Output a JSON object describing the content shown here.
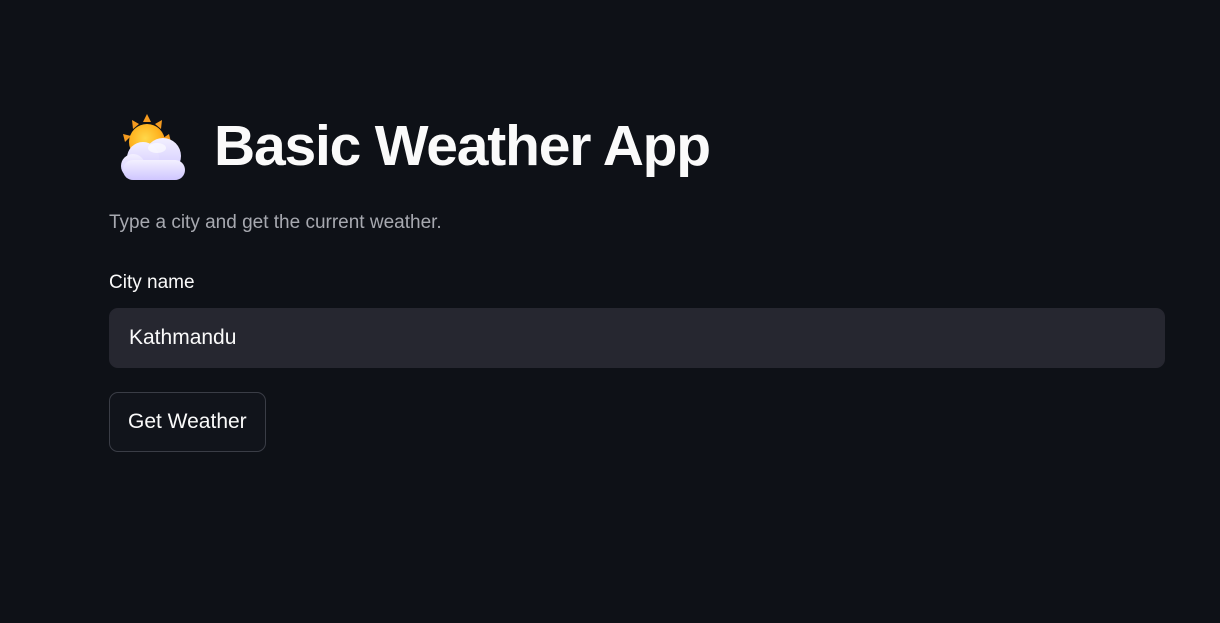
{
  "header": {
    "icon": "sun-behind-cloud-icon",
    "title": "Basic Weather App"
  },
  "main": {
    "subtitle": "Type a city and get the current weather.",
    "city_field": {
      "label": "City name",
      "value": "Kathmandu",
      "placeholder": ""
    },
    "get_weather_label": "Get Weather"
  },
  "colors": {
    "background": "#0e1117",
    "input_background": "#262730",
    "text": "#fafafa",
    "muted_text": "#a7a9b0",
    "button_border": "#3a3d46"
  }
}
